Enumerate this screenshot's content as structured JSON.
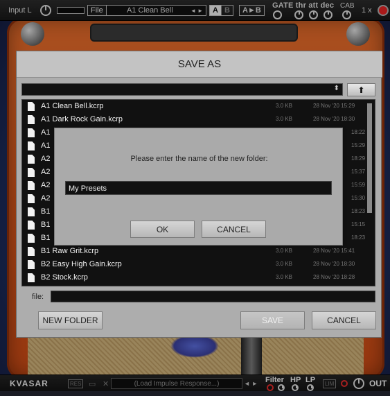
{
  "topbar": {
    "input_label": "Input L",
    "file_label": "File",
    "preset_name": "A1 Clean Bell",
    "preset_prev_next": "◄ ►",
    "ab_a": "A",
    "ab_b": "B",
    "a_to_b": "A►B",
    "gate_label": "GATE thr att dec",
    "cab_label": "CAB",
    "zoom": "1 x"
  },
  "bottombar": {
    "brand": "KVASAR",
    "res_label": "RES",
    "load_ir": "(Load Impulse Response...)",
    "filter_label": "Filter",
    "hp_label": "HP",
    "lp_label": "LP",
    "lim_label": "LIM",
    "out_label": "OUT"
  },
  "dialog": {
    "title": "SAVE AS",
    "up_icon": "up-arrow-icon",
    "file_label": "file:",
    "buttons": {
      "new_folder": "NEW FOLDER",
      "save": "SAVE",
      "cancel": "CANCEL"
    },
    "files": [
      {
        "name": "A1 Clean Bell.kcrp",
        "size": "3.0 KB",
        "date": "28 Nov '20 15:29"
      },
      {
        "name": "A1 Dark Rock Gain.kcrp",
        "size": "3.0 KB",
        "date": "28 Nov '20 18:30"
      },
      {
        "name": "A1",
        "size": "",
        "date": "18:22"
      },
      {
        "name": "A1",
        "size": "",
        "date": "15:29"
      },
      {
        "name": "A2",
        "size": "",
        "date": "18:29"
      },
      {
        "name": "A2",
        "size": "",
        "date": "15:37"
      },
      {
        "name": "A2",
        "size": "",
        "date": "15:59"
      },
      {
        "name": "A2",
        "size": "",
        "date": "15:30"
      },
      {
        "name": "B1",
        "size": "",
        "date": "18:23"
      },
      {
        "name": "B1",
        "size": "",
        "date": "15:15"
      },
      {
        "name": "B1",
        "size": "",
        "date": "18:23"
      },
      {
        "name": "B1 Raw Grit.kcrp",
        "size": "3.0 KB",
        "date": "28 Nov '20 15:41"
      },
      {
        "name": "B2 Easy High Gain.kcrp",
        "size": "3.0 KB",
        "date": "28 Nov '20 18:30"
      },
      {
        "name": "B2 Stock.kcrp",
        "size": "3.0 KB",
        "date": "28 Nov '20 18:28"
      }
    ]
  },
  "prompt": {
    "message": "Please enter the name of the new folder:",
    "value": "My Presets",
    "ok": "OK",
    "cancel": "CANCEL"
  }
}
